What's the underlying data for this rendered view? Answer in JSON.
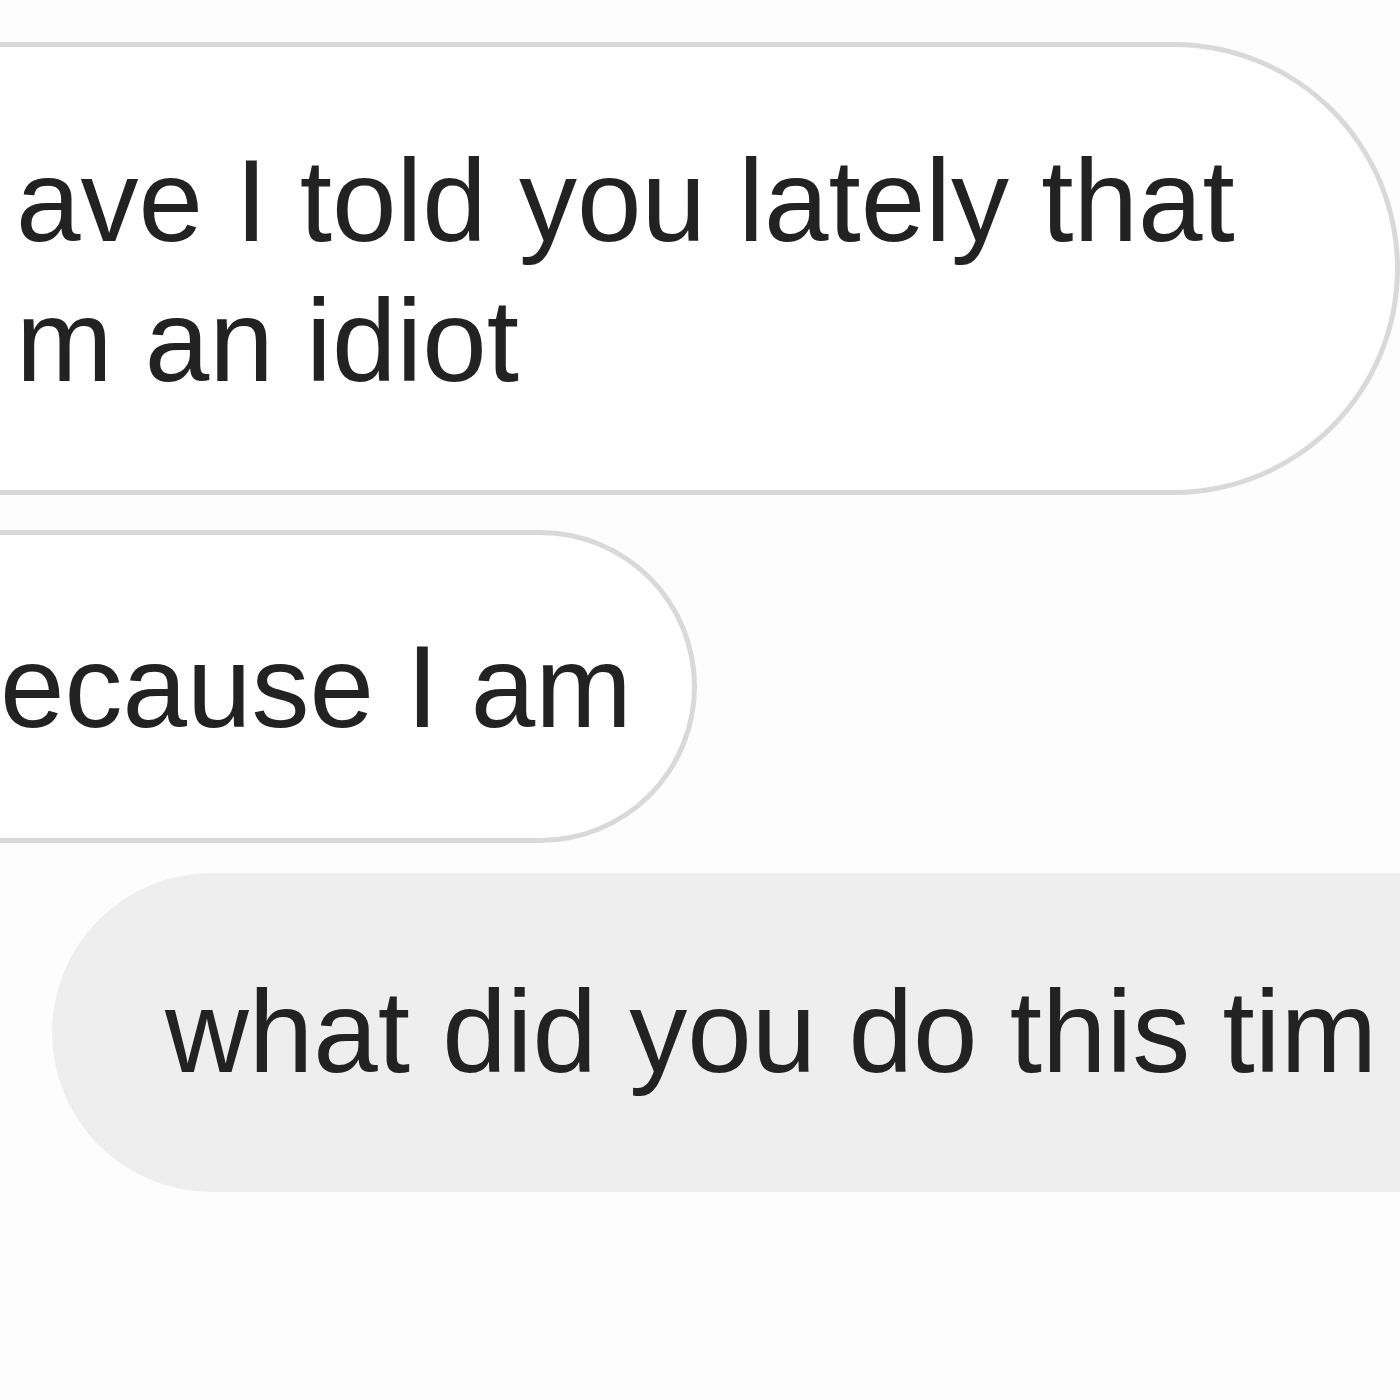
{
  "messages": [
    {
      "kind": "received",
      "lines": [
        "ave I told you lately that",
        "m an idiot"
      ]
    },
    {
      "kind": "received",
      "lines": [
        "ecause I am"
      ]
    },
    {
      "kind": "sent",
      "lines": [
        "what did you do this tim"
      ]
    }
  ]
}
